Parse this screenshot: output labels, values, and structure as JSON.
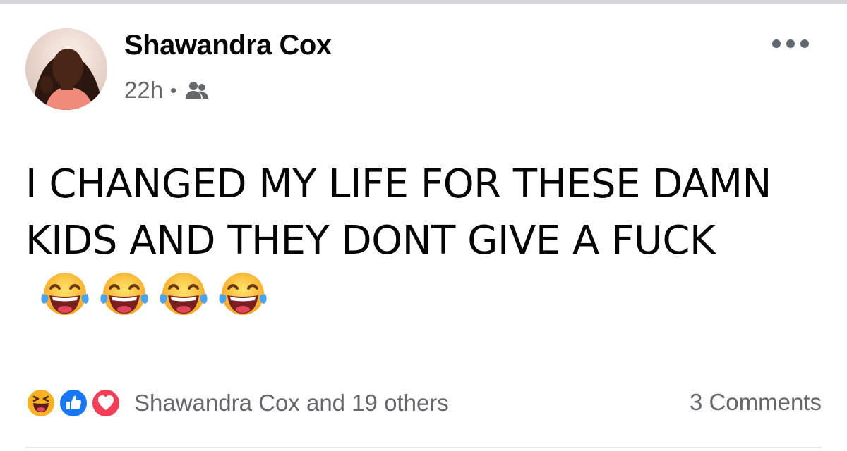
{
  "post": {
    "author": "Shawandra Cox",
    "timestamp": "22h",
    "separator": "•",
    "audience_icon": "friends-icon",
    "text": "I CHANGED MY LIFE FOR THESE DAMN KIDS AND THEY DONT GIVE A FUCK",
    "emoji": [
      "face-with-tears-of-joy",
      "face-with-tears-of-joy",
      "face-with-tears-of-joy",
      "face-with-tears-of-joy"
    ]
  },
  "reactions": {
    "icons": [
      "haha-reaction-icon",
      "like-reaction-icon",
      "love-reaction-icon"
    ],
    "summary": "Shawandra Cox and 19 others"
  },
  "comments": {
    "label": "3 Comments"
  },
  "colors": {
    "like_blue": "#1877f2",
    "love_red": "#f33e58",
    "haha_yellow": "#f7b125",
    "meta_gray": "#65676b"
  }
}
